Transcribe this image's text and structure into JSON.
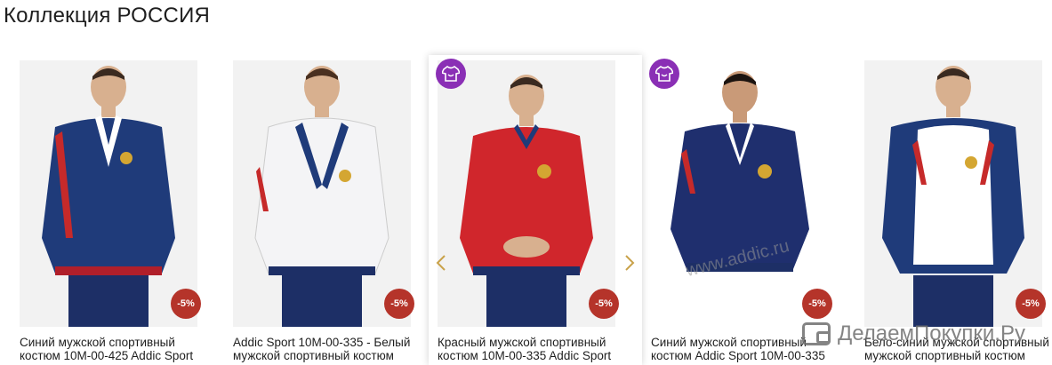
{
  "page": {
    "title": "Коллекция РОССИЯ"
  },
  "products": [
    {
      "name": "Синий мужской спортивный костюм 10M-00-425 Addic Sport",
      "discount": "-5%",
      "badge": false,
      "jacket_color": "#1f3b7a",
      "accent_color": "#c62a2a",
      "panel_color": "#ffffff"
    },
    {
      "name": "Addic Sport 10M-00-335 - Белый мужской спортивный костюм",
      "discount": "-5%",
      "badge": false,
      "jacket_color": "#f4f4f6",
      "accent_color": "#1f3b7a",
      "panel_color": "#c62a2a"
    },
    {
      "name": "Красный мужской спортивный костюм 10M-00-335 Addic Sport",
      "discount": "-5%",
      "badge": true,
      "jacket_color": "#d0262c",
      "accent_color": "#1f3b7a",
      "panel_color": "#ffffff"
    },
    {
      "name": "Синий мужской спортивный костюм Addic Sport 10M-00-335",
      "discount": "-5%",
      "badge": true,
      "jacket_color": "#1f2f6e",
      "accent_color": "#ffffff",
      "panel_color": "#c62a2a"
    },
    {
      "name": "Бело-синий мужской спортивный мужской спортивный костюм",
      "discount": "-5%",
      "badge": false,
      "jacket_color": "#ffffff",
      "accent_color": "#1f3b7a",
      "panel_color": "#c62a2a"
    }
  ],
  "carousel": {
    "prev_icon": "chevron-left-icon",
    "next_icon": "chevron-right-icon",
    "arrow_color": "#c9a24a"
  },
  "watermark": {
    "text": "www.addic.ru"
  },
  "site_mark": {
    "text": "ДелаемПокупки.Ру"
  },
  "colors": {
    "discount_badge": "#b5342a",
    "new_badge": "#8a2fb5"
  }
}
